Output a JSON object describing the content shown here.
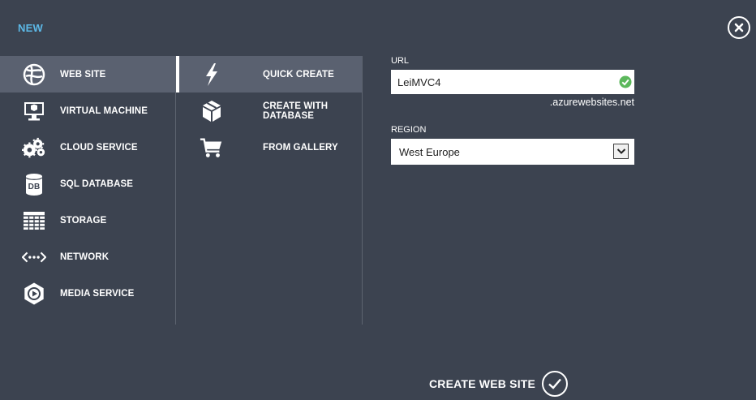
{
  "header": {
    "title": "NEW",
    "close_icon": "close-icon"
  },
  "categories": [
    {
      "label": "WEB SITE",
      "icon": "globe-icon",
      "selected": true
    },
    {
      "label": "VIRTUAL MACHINE",
      "icon": "monitor-icon",
      "selected": false
    },
    {
      "label": "CLOUD SERVICE",
      "icon": "gears-icon",
      "selected": false
    },
    {
      "label": "SQL DATABASE",
      "icon": "database-icon",
      "selected": false
    },
    {
      "label": "STORAGE",
      "icon": "grid-icon",
      "selected": false
    },
    {
      "label": "NETWORK",
      "icon": "network-icon",
      "selected": false
    },
    {
      "label": "MEDIA SERVICE",
      "icon": "media-icon",
      "selected": false
    }
  ],
  "db_icon_text": "DB",
  "options": [
    {
      "label": "QUICK CREATE",
      "icon": "lightning-icon",
      "selected": true
    },
    {
      "label": "CREATE WITH DATABASE",
      "icon": "box-icon",
      "selected": false
    },
    {
      "label": "FROM GALLERY",
      "icon": "cart-icon",
      "selected": false
    }
  ],
  "form": {
    "url_label": "URL",
    "url_value": "LeiMVC4",
    "url_suffix": ".azurewebsites.net",
    "region_label": "REGION",
    "region_value": "West Europe"
  },
  "footer": {
    "create_label": "CREATE WEB SITE"
  },
  "colors": {
    "background": "#3c4350",
    "selected": "#5a6170",
    "accent": "#5cb8e6",
    "valid": "#5cb85c"
  }
}
